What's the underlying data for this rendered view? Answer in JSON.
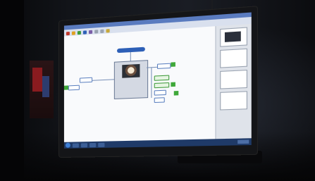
{
  "scene": {
    "description_colors": {
      "room": "#0c0d10",
      "screen": "#eef0f5",
      "taskbar": "#1f3a68",
      "accent": "#2d5fb7",
      "green": "#3fa83a"
    }
  },
  "app": {
    "title": "",
    "root_label": "",
    "center_label": ""
  },
  "icons": {
    "start": "windows-start-icon"
  }
}
